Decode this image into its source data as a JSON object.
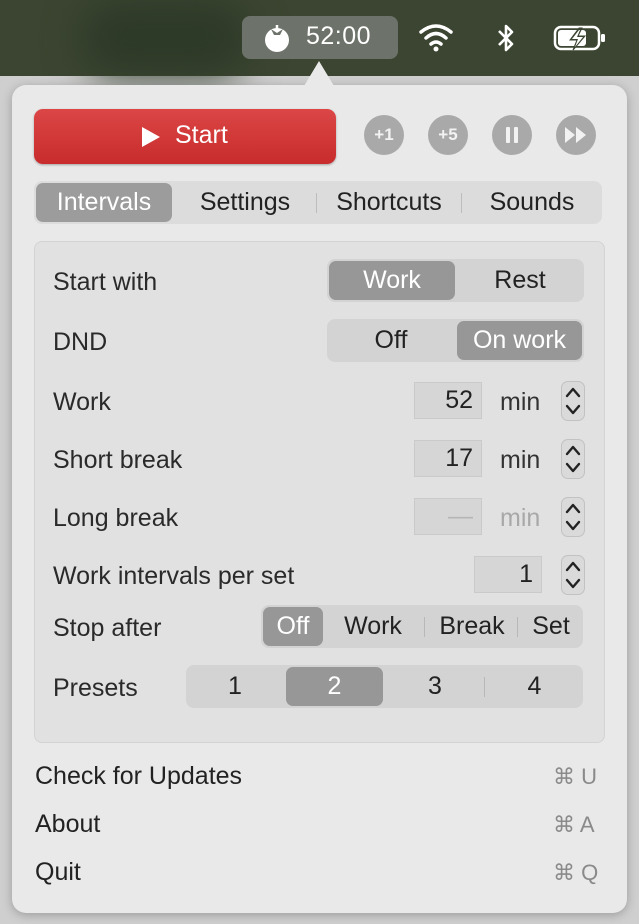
{
  "menubar": {
    "timer": "52:00",
    "icons": [
      "tomato-icon",
      "wifi-icon",
      "bluetooth-icon",
      "battery-charging-icon"
    ]
  },
  "controls": {
    "start_label": "Start",
    "add1_label": "+1",
    "add5_label": "+5",
    "icons": [
      "play-icon",
      "pause-icon",
      "skip-forward-icon"
    ]
  },
  "tabs": [
    {
      "label": "Intervals",
      "selected": true
    },
    {
      "label": "Settings"
    },
    {
      "label": "Shortcuts"
    },
    {
      "label": "Sounds"
    }
  ],
  "intervals": {
    "start_with": {
      "label": "Start with",
      "options": [
        "Work",
        "Rest"
      ],
      "selected": "Work"
    },
    "dnd": {
      "label": "DND",
      "options": [
        "Off",
        "On work"
      ],
      "selected": "On work"
    },
    "work": {
      "label": "Work",
      "value": "52",
      "unit": "min"
    },
    "short_break": {
      "label": "Short break",
      "value": "17",
      "unit": "min"
    },
    "long_break": {
      "label": "Long break",
      "value": "—",
      "unit": "min"
    },
    "per_set": {
      "label": "Work intervals per set",
      "value": "1"
    },
    "stop_after": {
      "label": "Stop after",
      "options": [
        "Off",
        "Work",
        "Break",
        "Set"
      ],
      "selected": "Off"
    },
    "presets": {
      "label": "Presets",
      "options": [
        "1",
        "2",
        "3",
        "4"
      ],
      "selected": "2"
    }
  },
  "menu": [
    {
      "label": "Check for Updates",
      "shortcut": "⌘ U"
    },
    {
      "label": "About",
      "shortcut": "⌘ A"
    },
    {
      "label": "Quit",
      "shortcut": "⌘ Q"
    }
  ],
  "colors": {
    "accent_red": "#d43a3a",
    "selected_segment": "#979797"
  }
}
